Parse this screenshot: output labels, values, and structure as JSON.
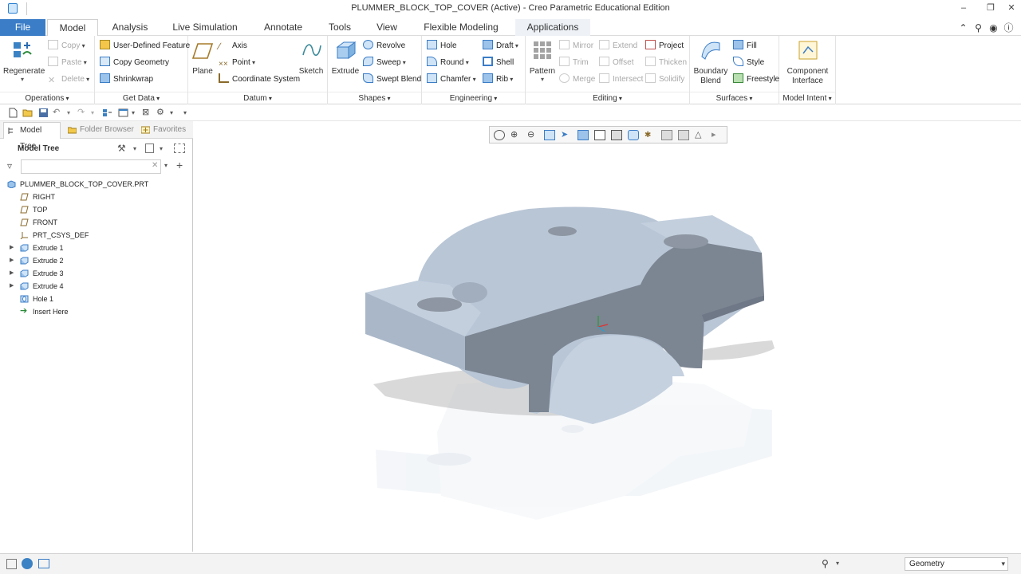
{
  "window": {
    "title": "PLUMMER_BLOCK_TOP_COVER (Active) - Creo Parametric Educational Edition",
    "controls": [
      "–",
      "❐",
      "✕"
    ]
  },
  "ribbon_tabs": [
    "File",
    "Model",
    "Analysis",
    "Live Simulation",
    "Annotate",
    "Tools",
    "View",
    "Flexible Modeling",
    "Applications"
  ],
  "active_tab": "Model",
  "ribbon": {
    "operations": {
      "label": "Operations",
      "regenerate": "Regenerate",
      "copy": "Copy",
      "paste": "Paste",
      "delete": "Delete"
    },
    "get_data": {
      "label": "Get Data",
      "udf": "User-Defined Feature",
      "copy_geometry": "Copy Geometry",
      "shrinkwrap": "Shrinkwrap"
    },
    "datum": {
      "label": "Datum",
      "plane": "Plane",
      "axis": "Axis",
      "point": "Point",
      "coordinate_system": "Coordinate System",
      "sketch": "Sketch"
    },
    "shapes": {
      "label": "Shapes",
      "extrude": "Extrude",
      "revolve": "Revolve",
      "sweep": "Sweep",
      "swept_blend": "Swept Blend"
    },
    "engineering": {
      "label": "Engineering",
      "hole": "Hole",
      "round": "Round",
      "chamfer": "Chamfer",
      "draft": "Draft",
      "shell": "Shell",
      "rib": "Rib"
    },
    "editing": {
      "label": "Editing",
      "pattern": "Pattern",
      "mirror": "Mirror",
      "trim": "Trim",
      "merge": "Merge",
      "extend": "Extend",
      "offset": "Offset",
      "intersect": "Intersect",
      "project": "Project",
      "thicken": "Thicken",
      "solidify": "Solidify"
    },
    "surfaces": {
      "label": "Surfaces",
      "boundary_blend": "Boundary Blend",
      "fill": "Fill",
      "style": "Style",
      "freestyle": "Freestyle"
    },
    "model_intent": {
      "label": "Model Intent",
      "component_interface": "Component Interface"
    }
  },
  "panel_tabs": [
    "Model Tree",
    "Folder Browser",
    "Favorites"
  ],
  "model_tree": {
    "header": "Model Tree",
    "filter_value": "",
    "items": [
      {
        "label": "PLUMMER_BLOCK_TOP_COVER.PRT",
        "icon": "part-icon",
        "expandable": false
      },
      {
        "label": "RIGHT",
        "icon": "datum-plane-icon",
        "expandable": false
      },
      {
        "label": "TOP",
        "icon": "datum-plane-icon",
        "expandable": false
      },
      {
        "label": "FRONT",
        "icon": "datum-plane-icon",
        "expandable": false
      },
      {
        "label": "PRT_CSYS_DEF",
        "icon": "csys-icon",
        "expandable": false
      },
      {
        "label": "Extrude 1",
        "icon": "extrude-icon",
        "expandable": true
      },
      {
        "label": "Extrude 2",
        "icon": "extrude-icon",
        "expandable": true
      },
      {
        "label": "Extrude 3",
        "icon": "extrude-icon",
        "expandable": true
      },
      {
        "label": "Extrude 4",
        "icon": "extrude-icon",
        "expandable": true
      },
      {
        "label": "Hole 1",
        "icon": "hole-icon",
        "expandable": false
      },
      {
        "label": "Insert Here",
        "icon": "insert-arrow-icon",
        "expandable": false
      }
    ]
  },
  "status_bar": {
    "selection_filter": "Geometry"
  },
  "colors": {
    "accent": "#3b7dc7",
    "model_surface": "#b9c6d6",
    "model_dark": "#7c8592"
  }
}
